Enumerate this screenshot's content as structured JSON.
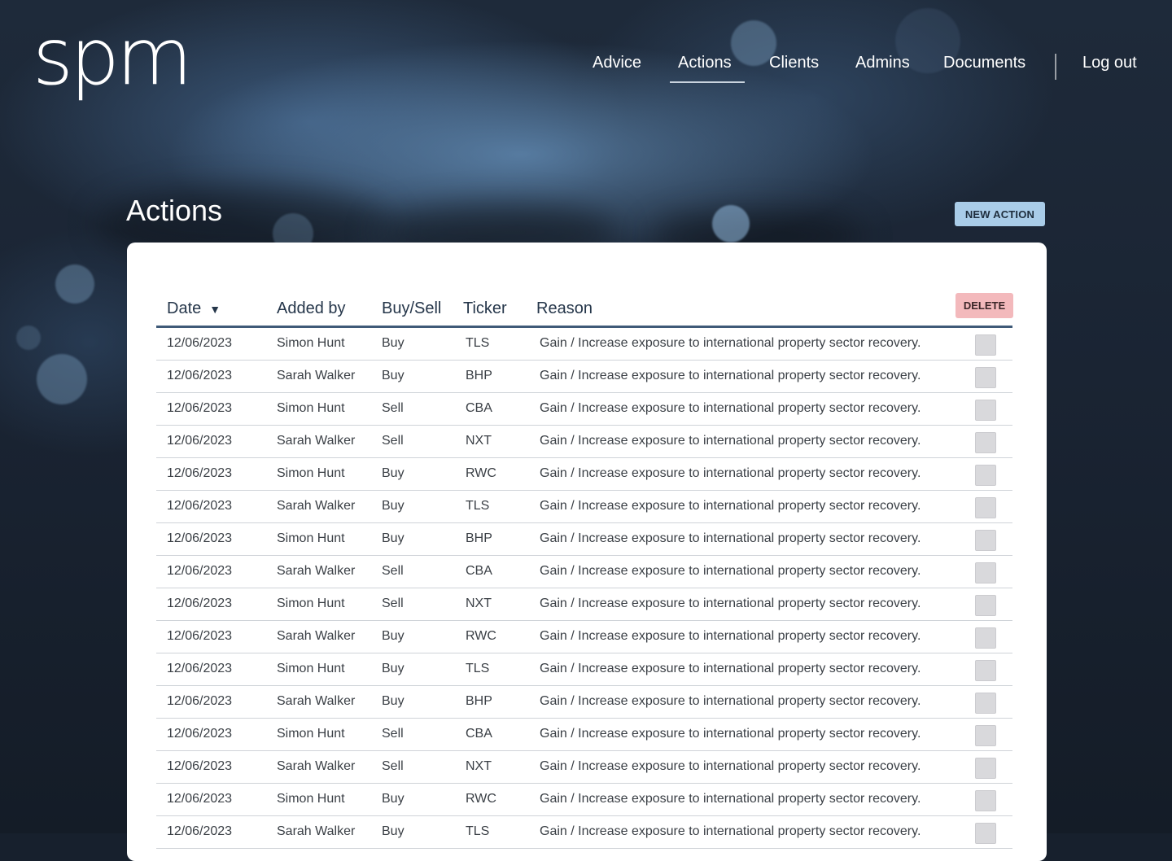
{
  "brand": {
    "logo_text": "spm"
  },
  "nav": {
    "items": [
      "Advice",
      "Actions",
      "Clients",
      "Admins",
      "Documents"
    ],
    "active": "Actions",
    "logout_label": "Log out"
  },
  "page": {
    "title": "Actions",
    "new_action_label": "NEW ACTION",
    "delete_label": "DELETE"
  },
  "table": {
    "columns": [
      "Date",
      "Added by",
      "Buy/Sell",
      "Ticker",
      "Reason"
    ],
    "sort": {
      "column": "Date",
      "direction": "descending",
      "icon": "caret-down-icon"
    },
    "rows": [
      {
        "date": "12/06/2023",
        "added_by": "Simon Hunt",
        "buy_sell": "Buy",
        "ticker": "TLS",
        "reason": "Gain / Increase exposure to international property sector recovery."
      },
      {
        "date": "12/06/2023",
        "added_by": "Sarah Walker",
        "buy_sell": "Buy",
        "ticker": "BHP",
        "reason": "Gain / Increase exposure to international property sector recovery."
      },
      {
        "date": "12/06/2023",
        "added_by": "Simon Hunt",
        "buy_sell": "Sell",
        "ticker": "CBA",
        "reason": "Gain / Increase exposure to international property sector recovery."
      },
      {
        "date": "12/06/2023",
        "added_by": "Sarah Walker",
        "buy_sell": "Sell",
        "ticker": "NXT",
        "reason": "Gain / Increase exposure to international property sector recovery."
      },
      {
        "date": "12/06/2023",
        "added_by": "Simon Hunt",
        "buy_sell": "Buy",
        "ticker": "RWC",
        "reason": "Gain / Increase exposure to international property sector recovery."
      },
      {
        "date": "12/06/2023",
        "added_by": "Sarah Walker",
        "buy_sell": "Buy",
        "ticker": "TLS",
        "reason": "Gain / Increase exposure to international property sector recovery."
      },
      {
        "date": "12/06/2023",
        "added_by": "Simon Hunt",
        "buy_sell": "Buy",
        "ticker": "BHP",
        "reason": "Gain / Increase exposure to international property sector recovery."
      },
      {
        "date": "12/06/2023",
        "added_by": "Sarah Walker",
        "buy_sell": "Sell",
        "ticker": "CBA",
        "reason": "Gain / Increase exposure to international property sector recovery."
      },
      {
        "date": "12/06/2023",
        "added_by": "Simon Hunt",
        "buy_sell": "Sell",
        "ticker": "NXT",
        "reason": "Gain / Increase exposure to international property sector recovery."
      },
      {
        "date": "12/06/2023",
        "added_by": "Sarah Walker",
        "buy_sell": "Buy",
        "ticker": "RWC",
        "reason": "Gain / Increase exposure to international property sector recovery."
      },
      {
        "date": "12/06/2023",
        "added_by": "Simon Hunt",
        "buy_sell": "Buy",
        "ticker": "TLS",
        "reason": "Gain / Increase exposure to international property sector recovery."
      },
      {
        "date": "12/06/2023",
        "added_by": "Sarah Walker",
        "buy_sell": "Buy",
        "ticker": "BHP",
        "reason": "Gain / Increase exposure to international property sector recovery."
      },
      {
        "date": "12/06/2023",
        "added_by": "Simon Hunt",
        "buy_sell": "Sell",
        "ticker": "CBA",
        "reason": "Gain / Increase exposure to international property sector recovery."
      },
      {
        "date": "12/06/2023",
        "added_by": "Sarah Walker",
        "buy_sell": "Sell",
        "ticker": "NXT",
        "reason": "Gain / Increase exposure to international property sector recovery."
      },
      {
        "date": "12/06/2023",
        "added_by": "Simon Hunt",
        "buy_sell": "Buy",
        "ticker": "RWC",
        "reason": "Gain / Increase exposure to international property sector recovery."
      },
      {
        "date": "12/06/2023",
        "added_by": "Sarah Walker",
        "buy_sell": "Buy",
        "ticker": "TLS",
        "reason": "Gain / Increase exposure to international property sector recovery."
      }
    ]
  },
  "colors": {
    "new_action_button": "#a9cce8",
    "delete_button": "#f3b9bc",
    "header_rule": "#3f5a78",
    "checkbox": "#d9d9dc"
  }
}
